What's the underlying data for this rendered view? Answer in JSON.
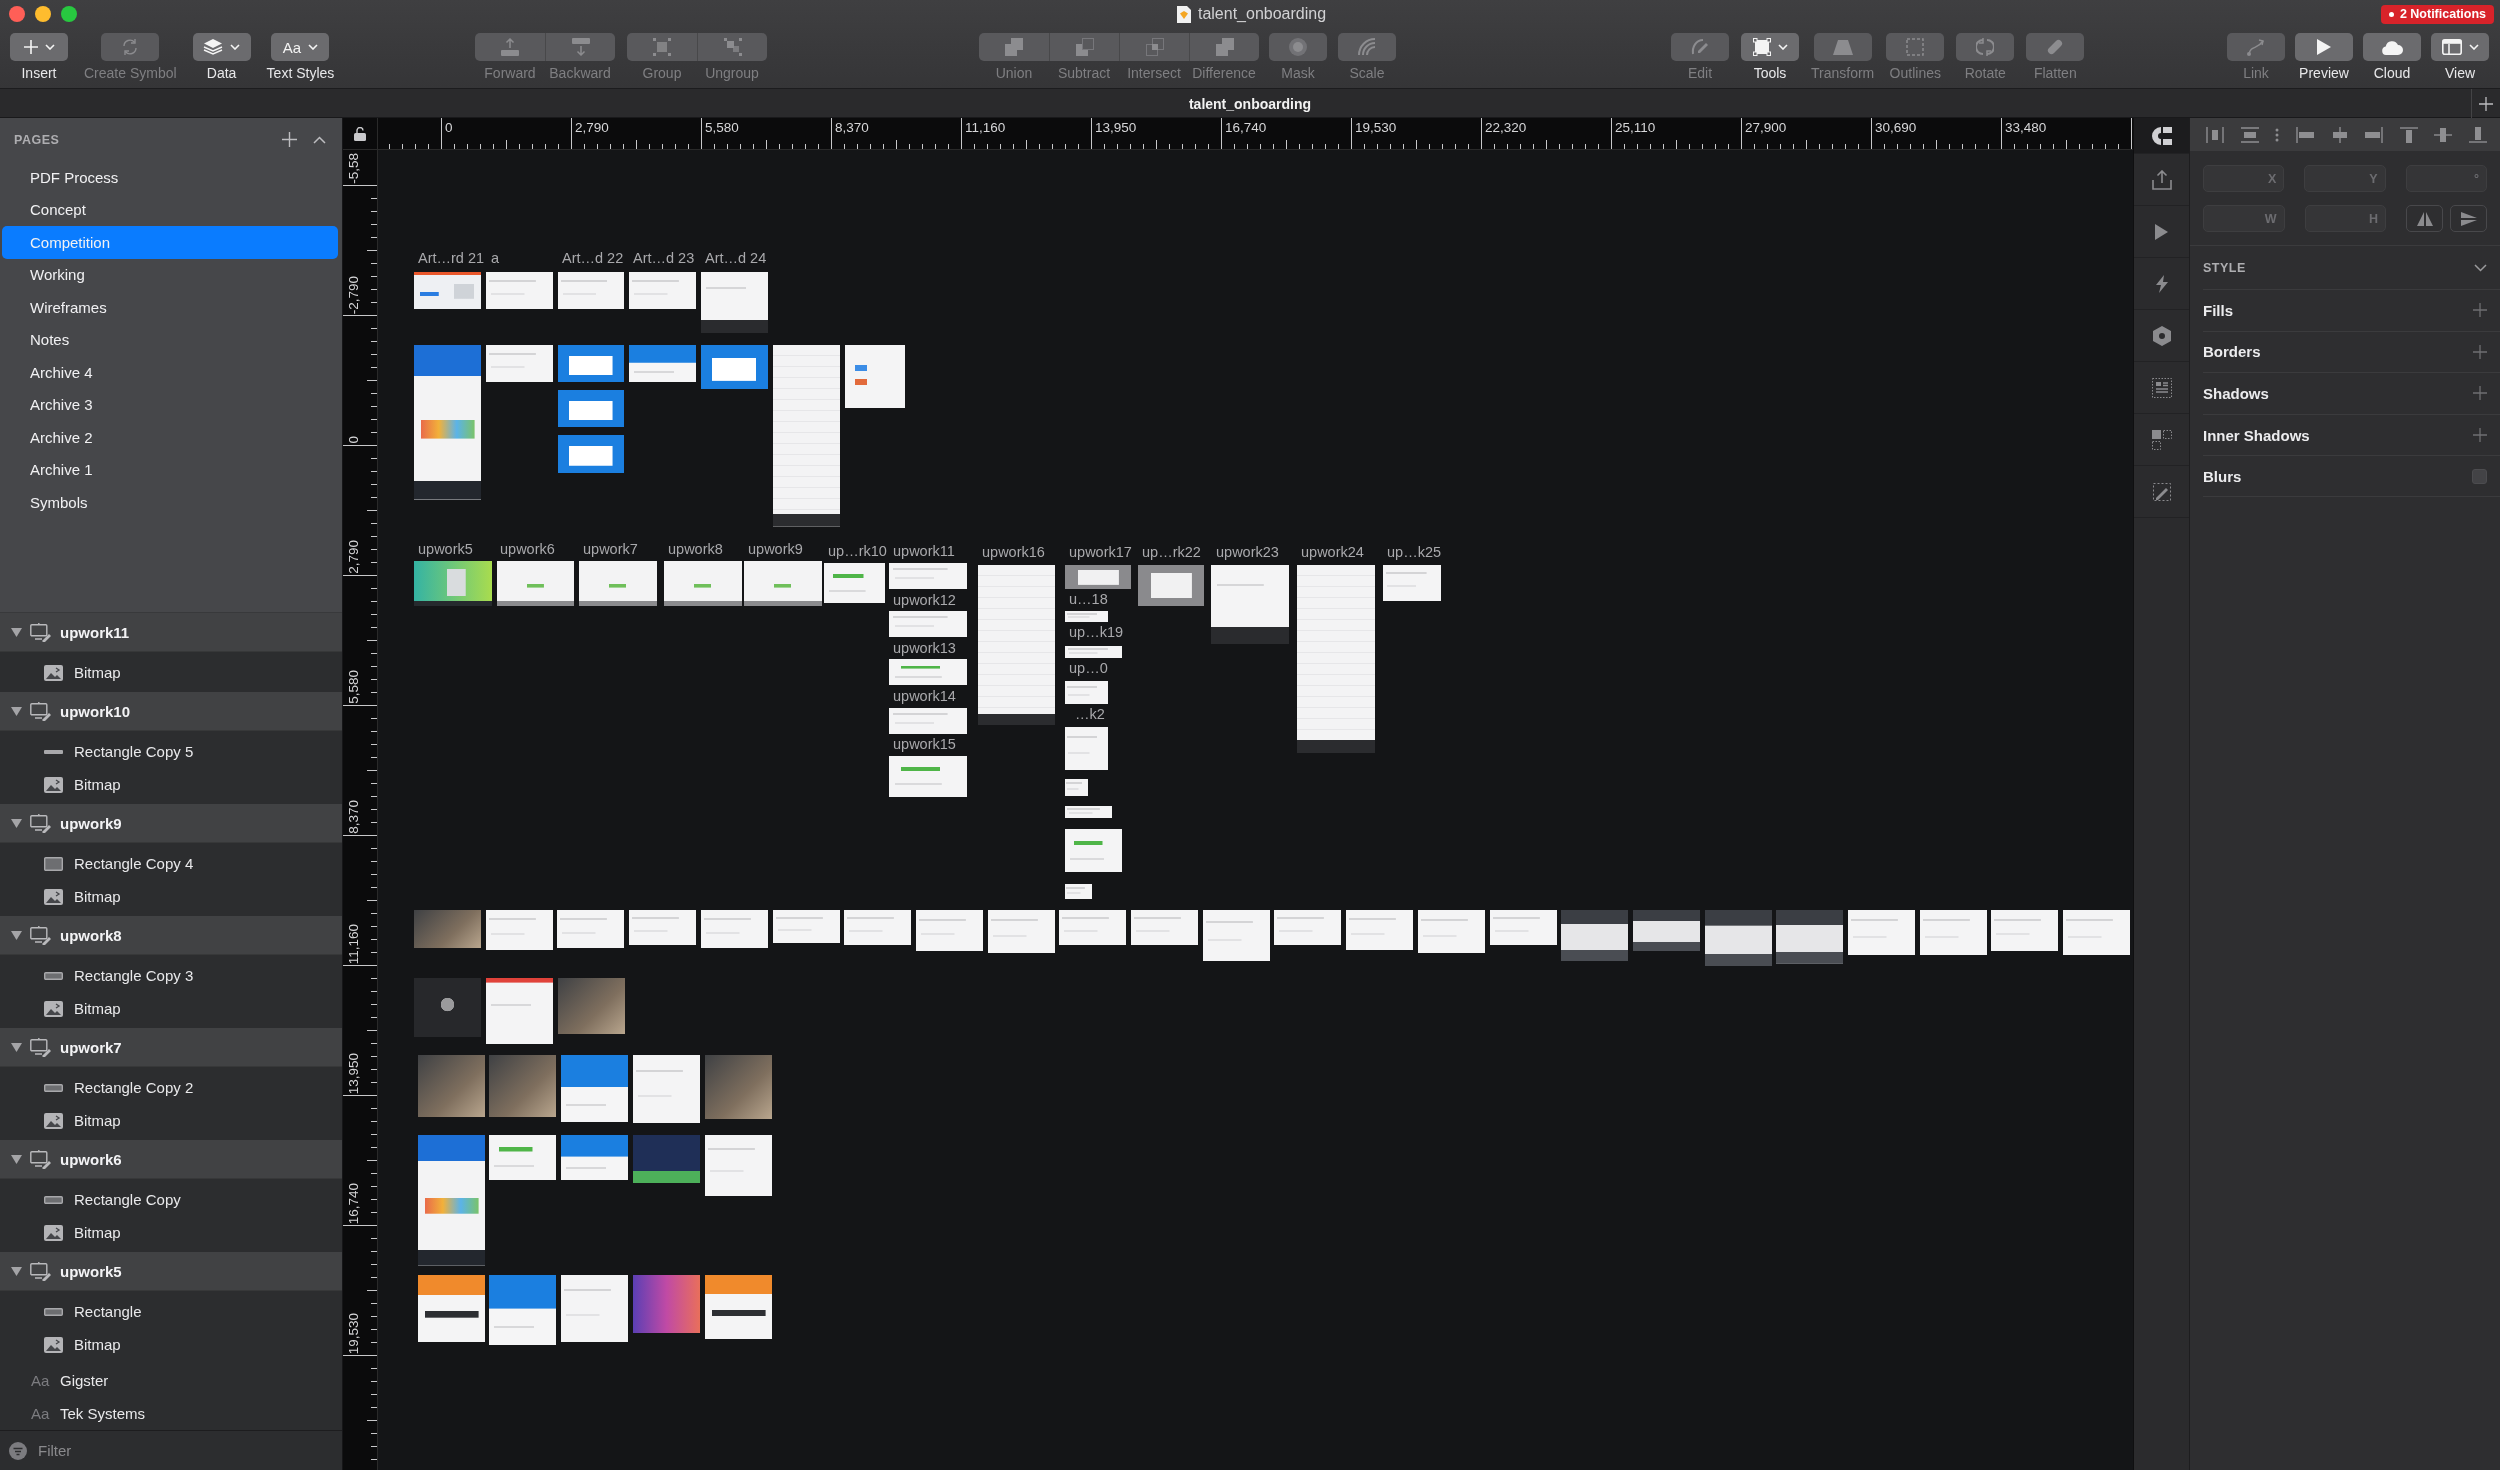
{
  "window": {
    "title": "talent_onboarding",
    "notifications": "2 Notifications"
  },
  "toolbar": [
    [
      {
        "label": "Insert",
        "kind": "insert",
        "menu": true,
        "disabled": false
      },
      {
        "label": "Create Symbol",
        "kind": "symbol",
        "disabled": true
      },
      {
        "label": "Data",
        "kind": "data",
        "menu": true,
        "disabled": false
      },
      {
        "label": "Text Styles",
        "kind": "textstyles",
        "icon_text": "Aa",
        "menu": true,
        "disabled": false
      }
    ],
    [
      {
        "label": "Forward",
        "kind": "forward",
        "disabled": true
      },
      {
        "label": "Backward",
        "kind": "backward",
        "disabled": true
      }
    ],
    [
      {
        "label": "Group",
        "kind": "group",
        "disabled": true
      },
      {
        "label": "Ungroup",
        "kind": "ungroup",
        "disabled": true
      }
    ],
    [
      {
        "label": "Union",
        "kind": "union",
        "disabled": true
      },
      {
        "label": "Subtract",
        "kind": "subtract",
        "disabled": true
      },
      {
        "label": "Intersect",
        "kind": "intersect",
        "disabled": true
      },
      {
        "label": "Difference",
        "kind": "difference",
        "disabled": true
      }
    ],
    [
      {
        "label": "Mask",
        "kind": "mask",
        "disabled": true
      },
      {
        "label": "Scale",
        "kind": "scale",
        "disabled": true
      }
    ],
    [
      {
        "label": "Edit",
        "kind": "edit",
        "disabled": true
      },
      {
        "label": "Tools",
        "kind": "tools",
        "menu": true,
        "disabled": false
      },
      {
        "label": "Transform",
        "kind": "transform",
        "disabled": true
      },
      {
        "label": "Outlines",
        "kind": "outlines",
        "disabled": true
      },
      {
        "label": "Rotate",
        "kind": "rotate",
        "disabled": true
      },
      {
        "label": "Flatten",
        "kind": "flatten",
        "disabled": true
      }
    ],
    [
      {
        "label": "Link",
        "kind": "link",
        "disabled": true
      },
      {
        "label": "Preview",
        "kind": "preview",
        "disabled": false
      },
      {
        "label": "Cloud",
        "kind": "cloud",
        "disabled": false
      },
      {
        "label": "View",
        "kind": "view",
        "menu": true,
        "disabled": false
      }
    ]
  ],
  "document_tab": {
    "title": "talent_onboarding"
  },
  "pages": {
    "header": "PAGES",
    "expanded": true,
    "items": [
      {
        "label": "PDF Process",
        "selected": false
      },
      {
        "label": "Concept",
        "selected": false
      },
      {
        "label": "Competition",
        "selected": true
      },
      {
        "label": "Working",
        "selected": false
      },
      {
        "label": "Wireframes",
        "selected": false
      },
      {
        "label": "Notes",
        "selected": false
      },
      {
        "label": "Archive 4",
        "selected": false
      },
      {
        "label": "Archive 3",
        "selected": false
      },
      {
        "label": "Archive 2",
        "selected": false
      },
      {
        "label": "Archive 1",
        "selected": false
      },
      {
        "label": "Symbols",
        "selected": false
      }
    ]
  },
  "layers": [
    {
      "name": "upwork11",
      "kind": "artboard",
      "expanded": true,
      "children": [
        {
          "name": "Bitmap",
          "kind": "bitmap"
        }
      ]
    },
    {
      "name": "upwork10",
      "kind": "artboard",
      "expanded": true,
      "children": [
        {
          "name": "Rectangle Copy 5",
          "kind": "line"
        },
        {
          "name": "Bitmap",
          "kind": "bitmap"
        }
      ]
    },
    {
      "name": "upwork9",
      "kind": "artboard",
      "expanded": true,
      "children": [
        {
          "name": "Rectangle Copy 4",
          "kind": "box"
        },
        {
          "name": "Bitmap",
          "kind": "bitmap"
        }
      ]
    },
    {
      "name": "upwork8",
      "kind": "artboard",
      "expanded": true,
      "children": [
        {
          "name": "Rectangle Copy 3",
          "kind": "rectangle"
        },
        {
          "name": "Bitmap",
          "kind": "bitmap"
        }
      ]
    },
    {
      "name": "upwork7",
      "kind": "artboard",
      "expanded": true,
      "children": [
        {
          "name": "Rectangle Copy 2",
          "kind": "rectangle"
        },
        {
          "name": "Bitmap",
          "kind": "bitmap"
        }
      ]
    },
    {
      "name": "upwork6",
      "kind": "artboard",
      "expanded": true,
      "children": [
        {
          "name": "Rectangle Copy",
          "kind": "rectangle"
        },
        {
          "name": "Bitmap",
          "kind": "bitmap"
        }
      ]
    },
    {
      "name": "upwork5",
      "kind": "artboard",
      "expanded": true,
      "children": [
        {
          "name": "Rectangle",
          "kind": "rectangle"
        },
        {
          "name": "Bitmap",
          "kind": "bitmap"
        }
      ]
    },
    {
      "name": "Gigster",
      "kind": "text",
      "icon_text": "Aa"
    },
    {
      "name": "Tek Systems",
      "kind": "text",
      "icon_text": "Aa"
    }
  ],
  "filter": {
    "placeholder": "Filter"
  },
  "rulers": {
    "horizontal": [
      "0",
      "2,790",
      "5,580",
      "8,370",
      "11,160",
      "13,950",
      "16,740",
      "19,530",
      "22,320",
      "25,110",
      "27,900",
      "30,690",
      "33,480"
    ],
    "vertical": [
      "-5,58",
      "-2,790",
      "0",
      "2,790",
      "5,580",
      "8,370",
      "11,160",
      "13,950",
      "16,740",
      "19,530"
    ]
  },
  "canvas": {
    "artboard_labels": [
      "Art…rd 21",
      "a",
      "Art…d 22",
      "Art…d 23",
      "Art…d 24",
      "upwork5",
      "upwork6",
      "upwork7",
      "upwork8",
      "upwork9",
      "up…rk10",
      "upwork11",
      "upwork16",
      "upwork17",
      "up…rk22",
      "upwork23",
      "upwork24",
      "up…k25",
      "upwork12",
      "upwork13",
      "upwork14",
      "upwork15",
      "u…18",
      "up…k19",
      "up…0",
      "…k2"
    ]
  },
  "inspector": {
    "fields": [
      {
        "label": "X"
      },
      {
        "label": "Y"
      },
      {
        "label": "°"
      },
      {
        "label": "W"
      },
      {
        "label": "H"
      }
    ],
    "style": {
      "header": "STYLE",
      "expanded": true,
      "sections": [
        {
          "label": "Fills",
          "kind": "add"
        },
        {
          "label": "Borders",
          "kind": "add"
        },
        {
          "label": "Shadows",
          "kind": "add"
        },
        {
          "label": "Inner Shadows",
          "kind": "add"
        },
        {
          "label": "Blurs",
          "kind": "toggle",
          "checked": false
        }
      ]
    }
  }
}
